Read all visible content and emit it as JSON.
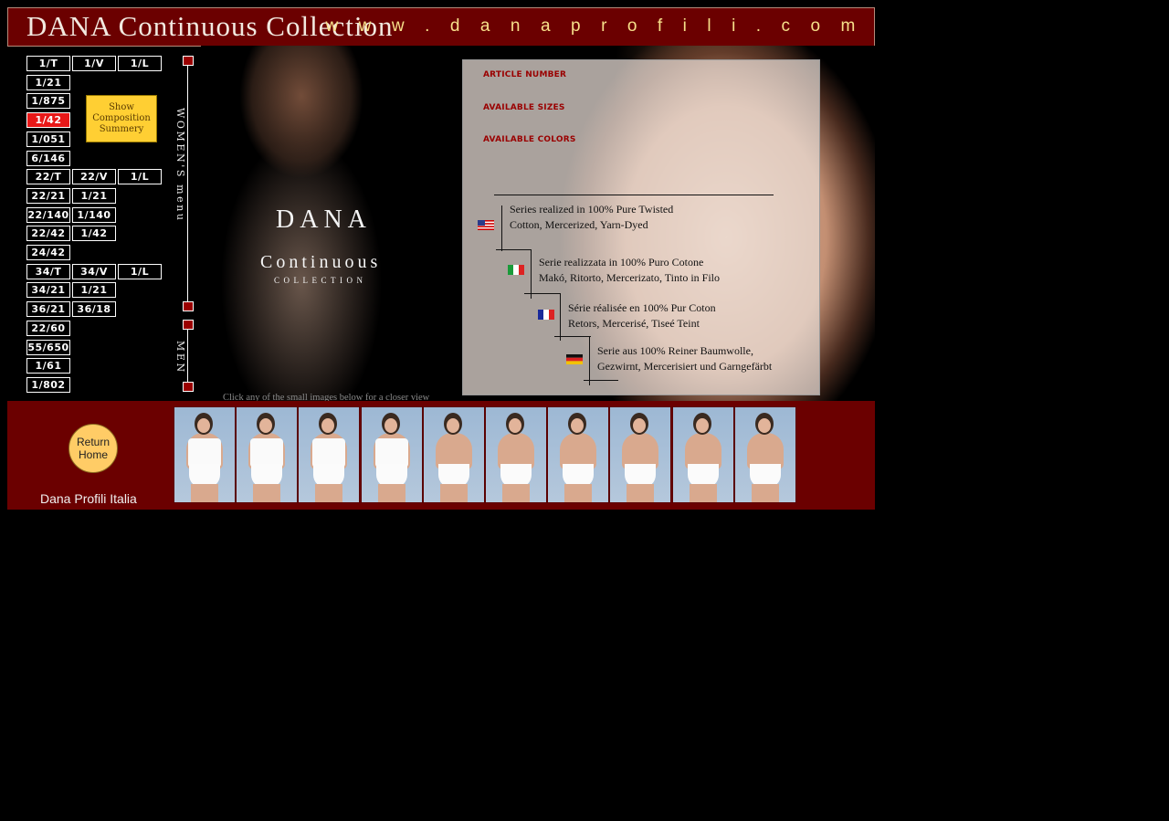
{
  "header": {
    "title": "DANA Continuous Collection",
    "url": "w w w . d a n a p r o f i l i . c o m"
  },
  "nav": {
    "women": [
      [
        "1/T",
        "1/V",
        "1/L"
      ],
      [
        "1/21"
      ],
      [
        "1/875"
      ],
      [
        "1/42"
      ],
      [
        "1/051"
      ],
      [
        "6/146"
      ],
      [
        "22/T",
        "22/V",
        "1/L"
      ],
      [
        "22/21",
        "1/21"
      ],
      [
        "22/140",
        "1/140"
      ],
      [
        "22/42",
        "1/42"
      ],
      [
        "24/42"
      ]
    ],
    "men": [
      [
        "34/T",
        "34/V",
        "1/L"
      ],
      [
        "34/21",
        "1/21"
      ],
      [
        "36/21",
        "36/18"
      ],
      [
        "22/60"
      ],
      [
        "55/650"
      ],
      [
        "1/61"
      ],
      [
        "1/802"
      ]
    ],
    "active": "1/42",
    "show_composition_label": "Show Composition Summery",
    "womens_menu_label": "WOMEN'S menu",
    "men_label": "MEN"
  },
  "hero": {
    "brand": "DANA",
    "continuous": "Continuous",
    "collection": "COLLECTION",
    "hint": "Click any of the small images below for a closer view"
  },
  "info": {
    "article_number_label": "ARTICLE NUMBER",
    "available_sizes_label": "AVAILABLE SIZES",
    "available_colors_label": "AVAILABLE COLORS",
    "descriptions": {
      "en": [
        "Series realized in 100% Pure Twisted",
        "Cotton, Mercerized, Yarn-Dyed"
      ],
      "it": [
        "Serie realizzata in 100% Puro Cotone",
        "Makó, Ritorto, Mercerizato, Tinto in Filo"
      ],
      "fr": [
        "Série réalisée en 100% Pur Coton",
        "Retors, Mercerisé, Tiseé Teint"
      ],
      "de": [
        "Serie aus 100% Reiner Baumwolle,",
        "Gezwirnt, Mercerisiert und Garngefärbt"
      ]
    }
  },
  "bottom": {
    "return_home_label": "Return Home",
    "brand_name": "Dana Profili Italia",
    "thumbnail_count": 10
  },
  "colors": {
    "header_bg": "#6b0000",
    "url_text": "#f7e08a",
    "active_button": "#e81818",
    "label_red": "#9a0000",
    "show_comp_button": "#ffcf33",
    "return_home_button": "#ffcc66"
  }
}
